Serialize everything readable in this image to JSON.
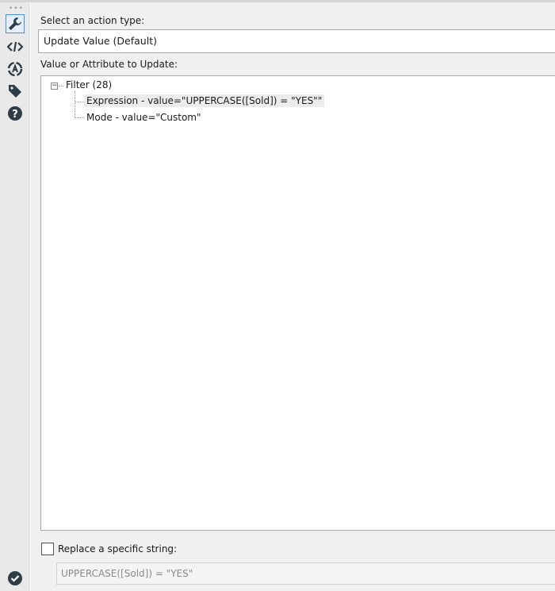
{
  "sidebar": {
    "icons": [
      "wrench-icon",
      "code-icon",
      "target-icon",
      "tag-icon",
      "help-icon"
    ],
    "status_icon": "check-circle-icon"
  },
  "action": {
    "label": "Select an action type:",
    "value": "Update Value (Default)"
  },
  "tree": {
    "label": "Value or Attribute to Update:",
    "root": "Filter (28)",
    "children": [
      "Expression - value=\"UPPERCASE([Sold]) = \"YES\"\"",
      "Mode - value=\"Custom\""
    ]
  },
  "replace": {
    "label": "Replace a specific string:",
    "checked": false,
    "value": "UPPERCASE([Sold]) = \"YES\""
  },
  "colors": {
    "icon": "#2f3d47",
    "accent": "#4a90d9"
  }
}
